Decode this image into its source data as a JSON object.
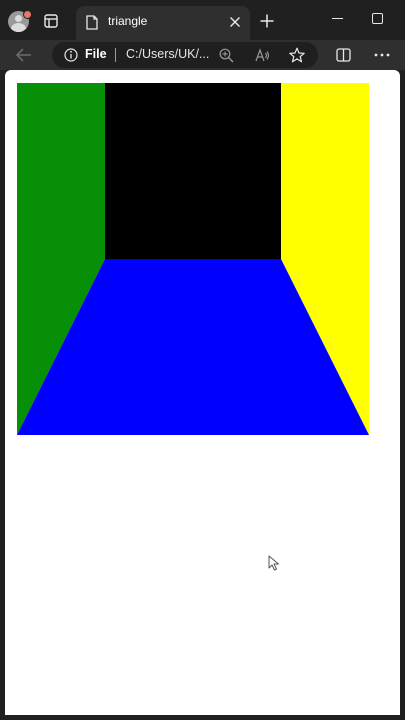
{
  "tab": {
    "title": "triangle"
  },
  "address_bar": {
    "scheme_label": "File",
    "url": "C:/Users/UK/..."
  },
  "scene": {
    "colors": {
      "left_wall": "#078f07",
      "back_wall": "#000000",
      "right_wall": "#ffff00",
      "floor": "#0000ff"
    }
  },
  "icons": {
    "profile": "avatar-icon",
    "tab_actions": "tab-actions-icon",
    "tab_page": "document-icon",
    "tab_close": "close-icon",
    "new_tab": "plus-icon",
    "minimize": "minimize-icon",
    "maximize": "maximize-icon",
    "back": "arrow-left-icon",
    "site_info": "info-icon",
    "zoom": "zoom-in-icon",
    "read_aloud": "read-aloud-icon",
    "favorite": "star-icon",
    "split_screen": "split-screen-icon",
    "more": "ellipsis-icon",
    "pointer": "cursor-icon"
  }
}
